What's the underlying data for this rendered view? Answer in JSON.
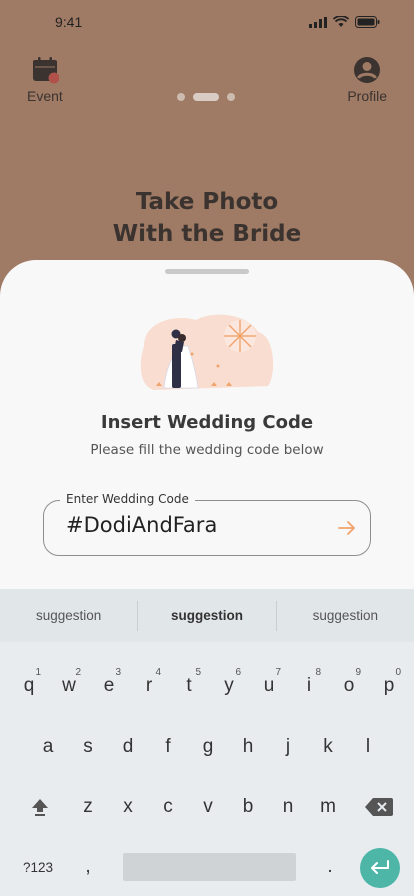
{
  "status_bar": {
    "time": "9:41"
  },
  "nav": {
    "event_label": "Event",
    "profile_label": "Profile"
  },
  "hero": {
    "title_line1": "Take Photo",
    "title_line2": "With the Bride"
  },
  "sheet": {
    "title": "Insert Wedding Code",
    "subtitle": "Please fill the wedding code below",
    "field_label": "Enter Wedding Code",
    "field_value": "#DodiAndFara"
  },
  "keyboard": {
    "suggestions": [
      "suggestion",
      "suggestion",
      "suggestion"
    ],
    "row1": [
      {
        "k": "q",
        "n": "1"
      },
      {
        "k": "w",
        "n": "2"
      },
      {
        "k": "e",
        "n": "3"
      },
      {
        "k": "r",
        "n": "4"
      },
      {
        "k": "t",
        "n": "5"
      },
      {
        "k": "y",
        "n": "6"
      },
      {
        "k": "u",
        "n": "7"
      },
      {
        "k": "i",
        "n": "8"
      },
      {
        "k": "o",
        "n": "9"
      },
      {
        "k": "p",
        "n": "0"
      }
    ],
    "row2": [
      "a",
      "s",
      "d",
      "f",
      "g",
      "h",
      "j",
      "k",
      "l"
    ],
    "row3": [
      "z",
      "x",
      "c",
      "v",
      "b",
      "n",
      "m"
    ],
    "symbols_label": "?123",
    "comma_label": ",",
    "period_label": "."
  },
  "colors": {
    "background": "#9f7a64",
    "accent": "#f0a46b",
    "enter": "#4db6a7"
  }
}
